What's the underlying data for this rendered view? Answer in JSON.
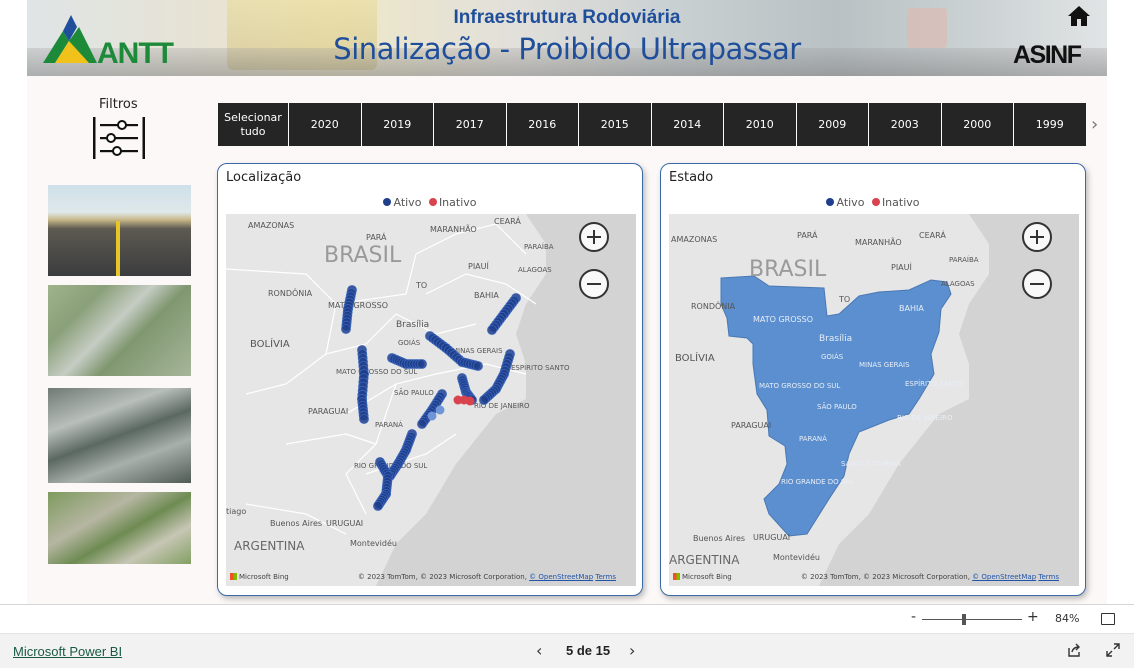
{
  "header": {
    "subtitle": "Infraestrutura Rodoviária",
    "title": "Sinalização - Proibido Ultrapassar",
    "logo_left_text": "ANTT",
    "logo_right_text": "ASINF"
  },
  "filters": {
    "label": "Filtros"
  },
  "year_tabs": {
    "select_all": "Selecionar tudo",
    "years": [
      "2020",
      "2019",
      "2017",
      "2016",
      "2015",
      "2014",
      "2010",
      "2009",
      "2003",
      "2000",
      "1999"
    ]
  },
  "cards": {
    "location": {
      "title": "Localização",
      "legend": [
        {
          "label": "Ativo",
          "color": "#1f3e8c"
        },
        {
          "label": "Inativo",
          "color": "#d9434e"
        }
      ]
    },
    "state": {
      "title": "Estado",
      "legend": [
        {
          "label": "Ativo",
          "color": "#1f3e8c"
        },
        {
          "label": "Inativo",
          "color": "#d9434e"
        }
      ]
    }
  },
  "map_labels": {
    "amazonas": "AMAZONAS",
    "para": "PARÁ",
    "maranhao": "MARANHÃO",
    "ceara": "CEARÁ",
    "paraiba": "PARAÍBA",
    "piaui": "PIAUÍ",
    "alagoas": "ALAGOAS",
    "brasil": "BRASIL",
    "rondonia": "RONDÔNIA",
    "to": "TO",
    "bahia": "BAHIA",
    "mato_grosso": "MATO GROSSO",
    "bolivia": "BOLÍVIA",
    "brasilia": "Brasília",
    "goias": "GOIÁS",
    "minas_gerais": "MINAS GERAIS",
    "mato_grosso_sul": "MATO GROSSO DO SUL",
    "espirito_santo": "ESPÍRITO SANTO",
    "paraguai": "PARAGUAI",
    "sao_paulo": "SÃO PAULO",
    "rio_janeiro": "RIO DE JANEIRO",
    "parana": "PARANÁ",
    "santa_catarina": "SANTA CATARINA",
    "rio_grande_sul": "RIO GRANDE DO SUL",
    "uruguai": "URUGUAI",
    "buenos_aires": "Buenos Aires",
    "argentina": "ARGENTINA",
    "montevideu": "Montevidéu",
    "tiago": "tiago",
    "es_abbr": "ESPÍRITO SANTO",
    "rio_abbr": "RIO DE JANEIRO"
  },
  "map_footer": {
    "bing": "Microsoft Bing",
    "credit_prefix": "© 2023 TomTom, © 2023 Microsoft Corporation, ",
    "osm": "© OpenStreetMap",
    "terms": "Terms"
  },
  "zoom_bar": {
    "minus": "-",
    "plus": "+",
    "level": "84%"
  },
  "footer": {
    "powerbi_link": "Microsoft Power BI",
    "page_label": "5 de 15"
  },
  "colors": {
    "brand_blue": "#1f4e9b",
    "active": "#1f3e8c",
    "inactive": "#d9434e",
    "state_fill": "#5b8fcf"
  },
  "icons": {
    "home": "home-icon",
    "filter": "sliders-icon",
    "next": "chevron-right-icon",
    "prev_page": "chevron-left-icon",
    "next_page": "chevron-right-icon",
    "share": "share-icon",
    "expand": "expand-icon",
    "fit": "fit-to-page-icon"
  }
}
